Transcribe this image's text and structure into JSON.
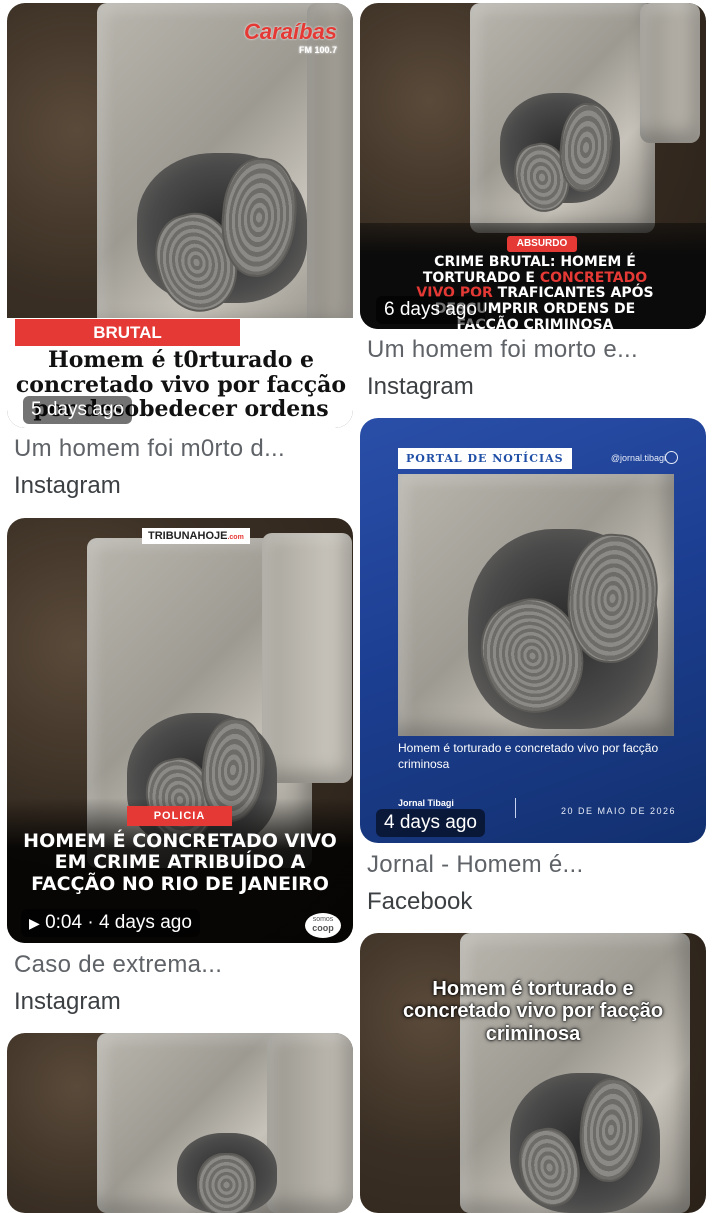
{
  "results": [
    {
      "brand": "Caraíbas",
      "brand_sub": "FM 100.7",
      "tag": "BRUTAL",
      "headline_line1": "Homem é t0rturado e",
      "headline_line2": "concretado vivo por facção",
      "headline_line3": "por desobedecer ordens",
      "time": "5 days ago",
      "title": "Um homem foi m0rto d...",
      "source": "Instagram"
    },
    {
      "tag": "ABSURDO",
      "headline_line1": "CRIME BRUTAL: HOMEM É",
      "headline_line2a": "TORTURADO E ",
      "headline_line2b": "CONCRETADO",
      "headline_line3a": "VIVO POR ",
      "headline_line3b": "TRAFICANTES APÓS",
      "headline_line4": "DESCUMPRIR ORDENS DE",
      "headline_line5": "FACÇÃO CRIMINOSA",
      "time": "6 days ago",
      "title": "Um homem foi morto e...",
      "source": "Instagram"
    },
    {
      "portal_label": "PORTAL DE NOTÍCIAS",
      "handle": "@jornal.tibagi",
      "headline": "Homem é torturado e concretado vivo por facção criminosa",
      "logo": "Jornal Tibagi",
      "date": "20 DE MAIO DE 2026",
      "time": "4 days ago",
      "title": "Jornal - Homem é...",
      "source": "Facebook"
    },
    {
      "brand": "TRIBUNAHOJE",
      "brand_suffix": ".com",
      "tag": "POLICIA",
      "headline_line1": "HOMEM É CONCRETADO VIVO",
      "headline_line2": "EM CRIME ATRIBUÍDO A",
      "headline_line3": "FACÇÃO NO RIO DE JANEIRO",
      "video_duration": "0:04",
      "time": "4 days ago",
      "watermark_line1": "somos",
      "watermark_line2": "coop",
      "title": "Caso de extrema...",
      "source": "Instagram"
    },
    {
      "headline_line1": "Homem é torturado e",
      "headline_line2": "concretado vivo por facção",
      "headline_line3": "criminosa"
    },
    {}
  ],
  "colors": {
    "accent_red": "#e53935",
    "portal_blue": "#1f4fa6",
    "caption_gray": "#5f6368"
  }
}
